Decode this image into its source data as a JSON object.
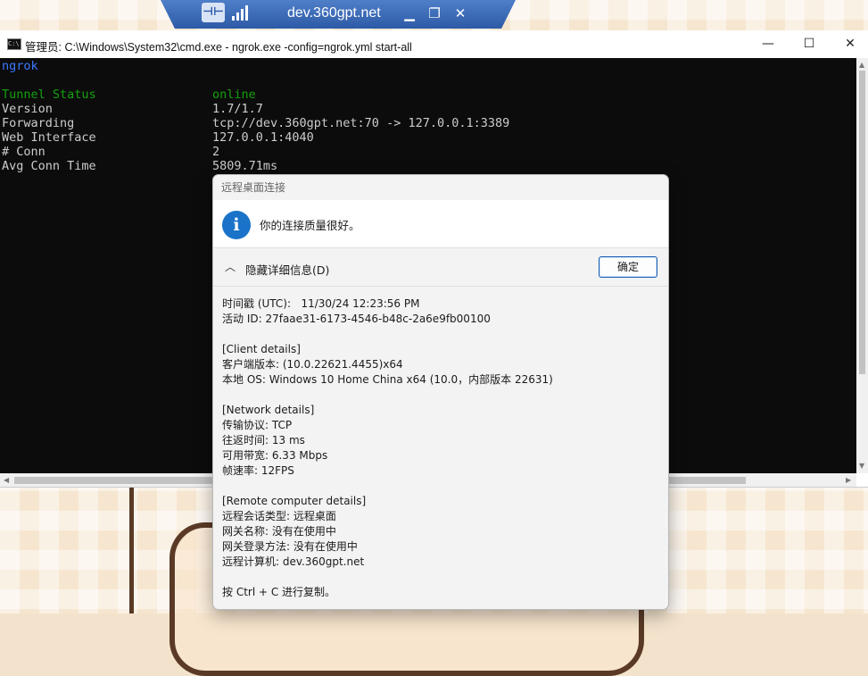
{
  "rdp_bar": {
    "title": "dev.360gpt.net",
    "pin_icon": "pin-icon",
    "signal_icon": "signal-icon",
    "buttons": {
      "minimize": "▁",
      "restore": "❐",
      "close": "✕"
    }
  },
  "cmd_window": {
    "title": "管理员: C:\\Windows\\System32\\cmd.exe - ngrok.exe  -config=ngrok.yml start-all",
    "buttons": {
      "minimize": "—",
      "maximize": "☐",
      "close": "✕"
    },
    "console": {
      "header": "ngrok",
      "rows": [
        {
          "label": "Tunnel Status",
          "value": "online",
          "color": "#13a10e"
        },
        {
          "label": "Version",
          "value": "1.7/1.7",
          "color": "#cccccc"
        },
        {
          "label": "Forwarding",
          "value": "tcp://dev.360gpt.net:70 -> 127.0.0.1:3389",
          "color": "#cccccc"
        },
        {
          "label": "Web Interface",
          "value": "127.0.0.1:4040",
          "color": "#cccccc"
        },
        {
          "label": "# Conn",
          "value": "2",
          "color": "#cccccc"
        },
        {
          "label": "Avg Conn Time",
          "value": "5809.71ms",
          "color": "#cccccc"
        }
      ],
      "header_color": "#3b78ff"
    }
  },
  "dialog": {
    "title": "远程桌面连接",
    "message": "你的连接质量很好。",
    "details_toggle": "隐藏详细信息(D)",
    "ok_label": "确定",
    "details": [
      "时间戳 (UTC):   11/30/24 12:23:56 PM",
      "活动 ID: 27faae31-6173-4546-b48c-2a6e9fb00100",
      "",
      "[Client details]",
      "客户端版本: (10.0.22621.4455)x64",
      "本地 OS: Windows 10 Home China x64 (10.0，内部版本 22631)",
      "",
      "[Network details]",
      "传输协议: TCP",
      "往返时间: 13 ms",
      "可用带宽: 6.33 Mbps",
      "帧速率: 12FPS",
      "",
      "[Remote computer details]",
      "远程会话类型: 远程桌面",
      "网关名称: 没有在使用中",
      "网关登录方法: 没有在使用中",
      "远程计算机: dev.360gpt.net",
      "",
      "按 Ctrl + C 进行复制。"
    ]
  }
}
